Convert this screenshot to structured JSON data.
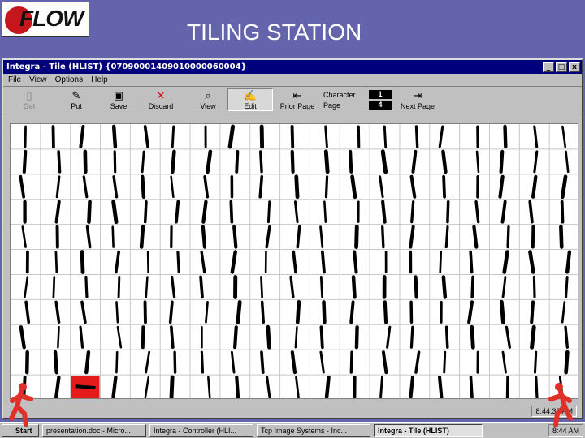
{
  "slide": {
    "logo_text": "FLOW",
    "title": "TILING STATION"
  },
  "window": {
    "title": "Integra - Tile (HLIST) {07090001409010000060004}",
    "controls": {
      "minimize": "_",
      "maximize": "□",
      "close": "x"
    }
  },
  "menu": [
    "File",
    "View",
    "Options",
    "Help"
  ],
  "toolbar": {
    "buttons": [
      {
        "label": "Get",
        "icon": "get-icon",
        "glyph": "▯",
        "enabled": false
      },
      {
        "label": "Put",
        "icon": "put-icon",
        "glyph": "✎",
        "enabled": true
      },
      {
        "label": "Save",
        "icon": "save-icon",
        "glyph": "▣",
        "enabled": true
      },
      {
        "label": "Discard",
        "icon": "discard-icon",
        "glyph": "✕",
        "enabled": true
      },
      {
        "label": "View",
        "icon": "view-icon",
        "glyph": "⌕",
        "enabled": true
      },
      {
        "label": "Edit",
        "icon": "edit-icon",
        "glyph": "✍",
        "enabled": true
      },
      {
        "label": "Prior Page",
        "icon": "prior-page-icon",
        "glyph": "⇤",
        "enabled": true
      },
      {
        "label": "Next Page",
        "icon": "next-page-icon",
        "glyph": "⇥",
        "enabled": true
      }
    ],
    "character_label": "Character",
    "character_value": "1",
    "page_label": "Page",
    "page_value": "4"
  },
  "status": {
    "clock": "8:44:33 AM"
  },
  "taskbar": {
    "start": "Start",
    "tasks": [
      {
        "label": "presentation.doc - Micro...",
        "active": false
      },
      {
        "label": "Integra - Controller (HLI...",
        "active": false
      },
      {
        "label": "Tcp Image Systems - Inc...",
        "active": false
      },
      {
        "label": "Integra - Tile (HLIST)",
        "active": true
      }
    ],
    "tray_time": "8:44 AM"
  },
  "colors": {
    "slide_bg": "#6464ac",
    "titlebar": "#00007c",
    "selected_tile": "#e51a1a",
    "runner": "#e0302a"
  }
}
